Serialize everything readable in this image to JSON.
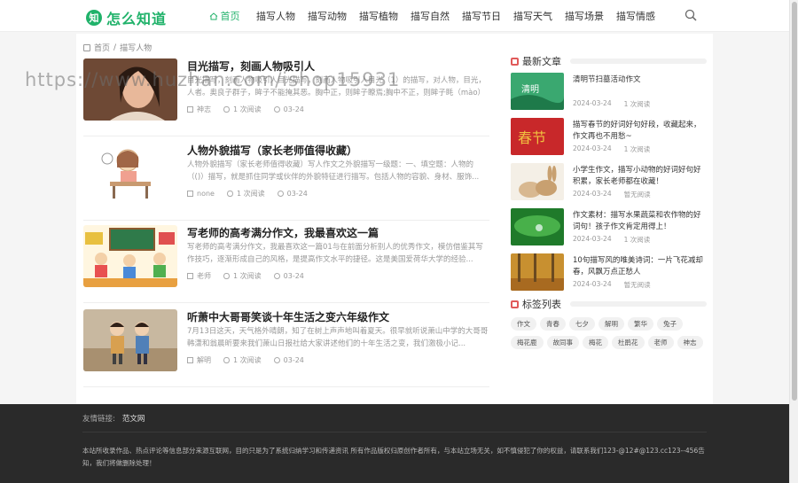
{
  "brand": {
    "name": "怎么知道",
    "mark": "知"
  },
  "nav": {
    "home_label": "首页",
    "items": [
      "描写人物",
      "描写动物",
      "描写植物",
      "描写自然",
      "描写节日",
      "描写天气",
      "描写场景",
      "描写情感"
    ]
  },
  "breadcrumb": {
    "home": "首页",
    "sep": "/",
    "current": "描写人物"
  },
  "articles": [
    {
      "title": "目光描写，刻画人物吸引人",
      "excerpt": "目光描写，刻画人物吸引人目光描写，刻画人物吸引人目光（1）的描写，对人物，目光，人者。奥良子群子，眸子不能掩其恶。胸中正，则眸子瞭焉;胸中不正，则眸子眊（mào）焉...",
      "author": "神志",
      "views": "1 次阅读",
      "date": "03-24"
    },
    {
      "title": "人物外貌描写（家长老师值得收藏）",
      "excerpt": "人物外貌描写（家长老师值得收藏）写人作文之外貌描写一级题：一、填空题：人物的（()）描写，就是抓住同学或伙伴的外貌特征进行描写。包括人物的容貌、身材、服饰...",
      "author": "none",
      "views": "1 次阅读",
      "date": "03-24"
    },
    {
      "title": "写老师的高考满分作文，我最喜欢这一篇",
      "excerpt": "写老师的高考满分作文，我最喜欢这一篇01与在前面分析别人的优秀作文，模仿借鉴其写作技巧，逐渐形成自己的风格，是提高作文水平的捷径。这是美国爱荷华大学的经验...",
      "author": "老师",
      "views": "1 次阅读",
      "date": "03-24"
    },
    {
      "title": "听萧中大哥哥笑谈十年生活之变六年级作文",
      "excerpt": "7月13日这天，天气格外晴朗，知了在树上声声地叫着夏天。很早就听说萧山中学的大哥哥韩潇和翁晨昕要来我们萧山日报社给大家讲述他们的十年生活之变，我们激极小记...",
      "author": "解明",
      "views": "1 次阅读",
      "date": "03-24"
    }
  ],
  "sidebar": {
    "recent_heading": "最新文章",
    "recent": [
      {
        "title": "清明节扫墓活动作文",
        "date": "2024-03-24",
        "views": "1 次阅读"
      },
      {
        "title": "描写春节的好词好句好段，收藏起来，作文再也不用愁~",
        "date": "2024-03-24",
        "views": "1 次阅读"
      },
      {
        "title": "小学生作文，描写小动物的好词好句好积累，家长老师都在收藏！",
        "date": "2024-03-24",
        "views": "暂无阅读"
      },
      {
        "title": "作文素材：描写水果蔬菜和农作物的好词句！孩子作文肯定用得上！",
        "date": "2024-03-24",
        "views": "1 次阅读"
      },
      {
        "title": "10句描写风的唯美诗词：一片飞花减却春，风飘万点正愁人",
        "date": "2024-03-24",
        "views": "暂无阅读"
      }
    ],
    "tags_heading": "标签列表",
    "tags": [
      "作文",
      "青春",
      "七夕",
      "解明",
      "繁华",
      "兔子",
      "梅花鹿",
      "故同事",
      "梅花",
      "杜鹃花",
      "老师",
      "神志"
    ]
  },
  "footer": {
    "links_label": "友情链接:",
    "links": [
      "范文网"
    ],
    "note": "本站所收录作品、热点评论等信息部分来源互联网，目的只是为了系统归纳学习和传递资讯 所有作品版权归原创作者所有，与本站立场无关，如不慎侵犯了你的权益，请联系我们123-@12#@123.cc123--456告知，我们将做删除处理！"
  },
  "watermark": "https://www.huzhan.com/ishop15931",
  "colors": {
    "accent": "#20b26a",
    "sidebar_icon": "#e05a5a",
    "footer_bg": "#2a2a2a"
  }
}
